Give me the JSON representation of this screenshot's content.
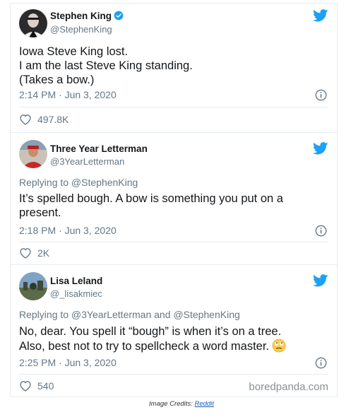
{
  "tweets": [
    {
      "name": "Stephen King",
      "handle": "@StephenKing",
      "verified": true,
      "reply_to": "",
      "text_lines": [
        "Iowa Steve King lost.",
        "I am the last Steve King standing.",
        "(Takes a bow.)"
      ],
      "timestamp": "2:14 PM · Jun 3, 2020",
      "likes": "497.8K"
    },
    {
      "name": "Three Year Letterman",
      "handle": "@3YearLetterman",
      "verified": false,
      "reply_to": "Replying to @StephenKing",
      "text_lines": [
        "It’s spelled bough. A bow is something you put on a",
        "present."
      ],
      "timestamp": "2:18 PM · Jun 3, 2020",
      "likes": "2K"
    },
    {
      "name": "Lisa Leland",
      "handle": "@_lisakmiec",
      "verified": false,
      "reply_to": "Replying to @3YearLetterman and @StephenKing",
      "text_lines": [
        "No, dear. You spell it “bough” is when it’s on a tree.",
        "Also, best not to try to spellcheck a word master."
      ],
      "timestamp": "2:25 PM · Jun 3, 2020",
      "likes": "540"
    }
  ],
  "watermark": "boredpanda.com",
  "credit": {
    "prefix": "Image Credits: ",
    "link": "Reddit"
  },
  "icons": {
    "bird": "twitter-bird-icon",
    "verified": "verified-badge-icon",
    "info": "info-icon",
    "heart": "heart-icon",
    "emoji": "eye-roll-emoji"
  },
  "colors": {
    "twitter_blue": "#1da1f2",
    "text": "#14171a",
    "muted": "#657786",
    "border": "#e6ecf0"
  }
}
